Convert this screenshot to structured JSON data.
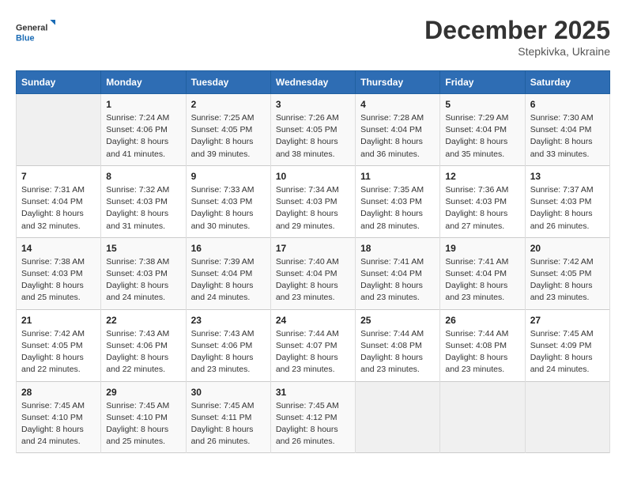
{
  "logo": {
    "line1": "General",
    "line2": "Blue"
  },
  "title": "December 2025",
  "subtitle": "Stepkivka, Ukraine",
  "days_header": [
    "Sunday",
    "Monday",
    "Tuesday",
    "Wednesday",
    "Thursday",
    "Friday",
    "Saturday"
  ],
  "weeks": [
    [
      {
        "num": "",
        "info": ""
      },
      {
        "num": "1",
        "info": "Sunrise: 7:24 AM\nSunset: 4:06 PM\nDaylight: 8 hours\nand 41 minutes."
      },
      {
        "num": "2",
        "info": "Sunrise: 7:25 AM\nSunset: 4:05 PM\nDaylight: 8 hours\nand 39 minutes."
      },
      {
        "num": "3",
        "info": "Sunrise: 7:26 AM\nSunset: 4:05 PM\nDaylight: 8 hours\nand 38 minutes."
      },
      {
        "num": "4",
        "info": "Sunrise: 7:28 AM\nSunset: 4:04 PM\nDaylight: 8 hours\nand 36 minutes."
      },
      {
        "num": "5",
        "info": "Sunrise: 7:29 AM\nSunset: 4:04 PM\nDaylight: 8 hours\nand 35 minutes."
      },
      {
        "num": "6",
        "info": "Sunrise: 7:30 AM\nSunset: 4:04 PM\nDaylight: 8 hours\nand 33 minutes."
      }
    ],
    [
      {
        "num": "7",
        "info": "Sunrise: 7:31 AM\nSunset: 4:04 PM\nDaylight: 8 hours\nand 32 minutes."
      },
      {
        "num": "8",
        "info": "Sunrise: 7:32 AM\nSunset: 4:03 PM\nDaylight: 8 hours\nand 31 minutes."
      },
      {
        "num": "9",
        "info": "Sunrise: 7:33 AM\nSunset: 4:03 PM\nDaylight: 8 hours\nand 30 minutes."
      },
      {
        "num": "10",
        "info": "Sunrise: 7:34 AM\nSunset: 4:03 PM\nDaylight: 8 hours\nand 29 minutes."
      },
      {
        "num": "11",
        "info": "Sunrise: 7:35 AM\nSunset: 4:03 PM\nDaylight: 8 hours\nand 28 minutes."
      },
      {
        "num": "12",
        "info": "Sunrise: 7:36 AM\nSunset: 4:03 PM\nDaylight: 8 hours\nand 27 minutes."
      },
      {
        "num": "13",
        "info": "Sunrise: 7:37 AM\nSunset: 4:03 PM\nDaylight: 8 hours\nand 26 minutes."
      }
    ],
    [
      {
        "num": "14",
        "info": "Sunrise: 7:38 AM\nSunset: 4:03 PM\nDaylight: 8 hours\nand 25 minutes."
      },
      {
        "num": "15",
        "info": "Sunrise: 7:38 AM\nSunset: 4:03 PM\nDaylight: 8 hours\nand 24 minutes."
      },
      {
        "num": "16",
        "info": "Sunrise: 7:39 AM\nSunset: 4:04 PM\nDaylight: 8 hours\nand 24 minutes."
      },
      {
        "num": "17",
        "info": "Sunrise: 7:40 AM\nSunset: 4:04 PM\nDaylight: 8 hours\nand 23 minutes."
      },
      {
        "num": "18",
        "info": "Sunrise: 7:41 AM\nSunset: 4:04 PM\nDaylight: 8 hours\nand 23 minutes."
      },
      {
        "num": "19",
        "info": "Sunrise: 7:41 AM\nSunset: 4:04 PM\nDaylight: 8 hours\nand 23 minutes."
      },
      {
        "num": "20",
        "info": "Sunrise: 7:42 AM\nSunset: 4:05 PM\nDaylight: 8 hours\nand 23 minutes."
      }
    ],
    [
      {
        "num": "21",
        "info": "Sunrise: 7:42 AM\nSunset: 4:05 PM\nDaylight: 8 hours\nand 22 minutes."
      },
      {
        "num": "22",
        "info": "Sunrise: 7:43 AM\nSunset: 4:06 PM\nDaylight: 8 hours\nand 22 minutes."
      },
      {
        "num": "23",
        "info": "Sunrise: 7:43 AM\nSunset: 4:06 PM\nDaylight: 8 hours\nand 23 minutes."
      },
      {
        "num": "24",
        "info": "Sunrise: 7:44 AM\nSunset: 4:07 PM\nDaylight: 8 hours\nand 23 minutes."
      },
      {
        "num": "25",
        "info": "Sunrise: 7:44 AM\nSunset: 4:08 PM\nDaylight: 8 hours\nand 23 minutes."
      },
      {
        "num": "26",
        "info": "Sunrise: 7:44 AM\nSunset: 4:08 PM\nDaylight: 8 hours\nand 23 minutes."
      },
      {
        "num": "27",
        "info": "Sunrise: 7:45 AM\nSunset: 4:09 PM\nDaylight: 8 hours\nand 24 minutes."
      }
    ],
    [
      {
        "num": "28",
        "info": "Sunrise: 7:45 AM\nSunset: 4:10 PM\nDaylight: 8 hours\nand 24 minutes."
      },
      {
        "num": "29",
        "info": "Sunrise: 7:45 AM\nSunset: 4:10 PM\nDaylight: 8 hours\nand 25 minutes."
      },
      {
        "num": "30",
        "info": "Sunrise: 7:45 AM\nSunset: 4:11 PM\nDaylight: 8 hours\nand 26 minutes."
      },
      {
        "num": "31",
        "info": "Sunrise: 7:45 AM\nSunset: 4:12 PM\nDaylight: 8 hours\nand 26 minutes."
      },
      {
        "num": "",
        "info": ""
      },
      {
        "num": "",
        "info": ""
      },
      {
        "num": "",
        "info": ""
      }
    ]
  ]
}
